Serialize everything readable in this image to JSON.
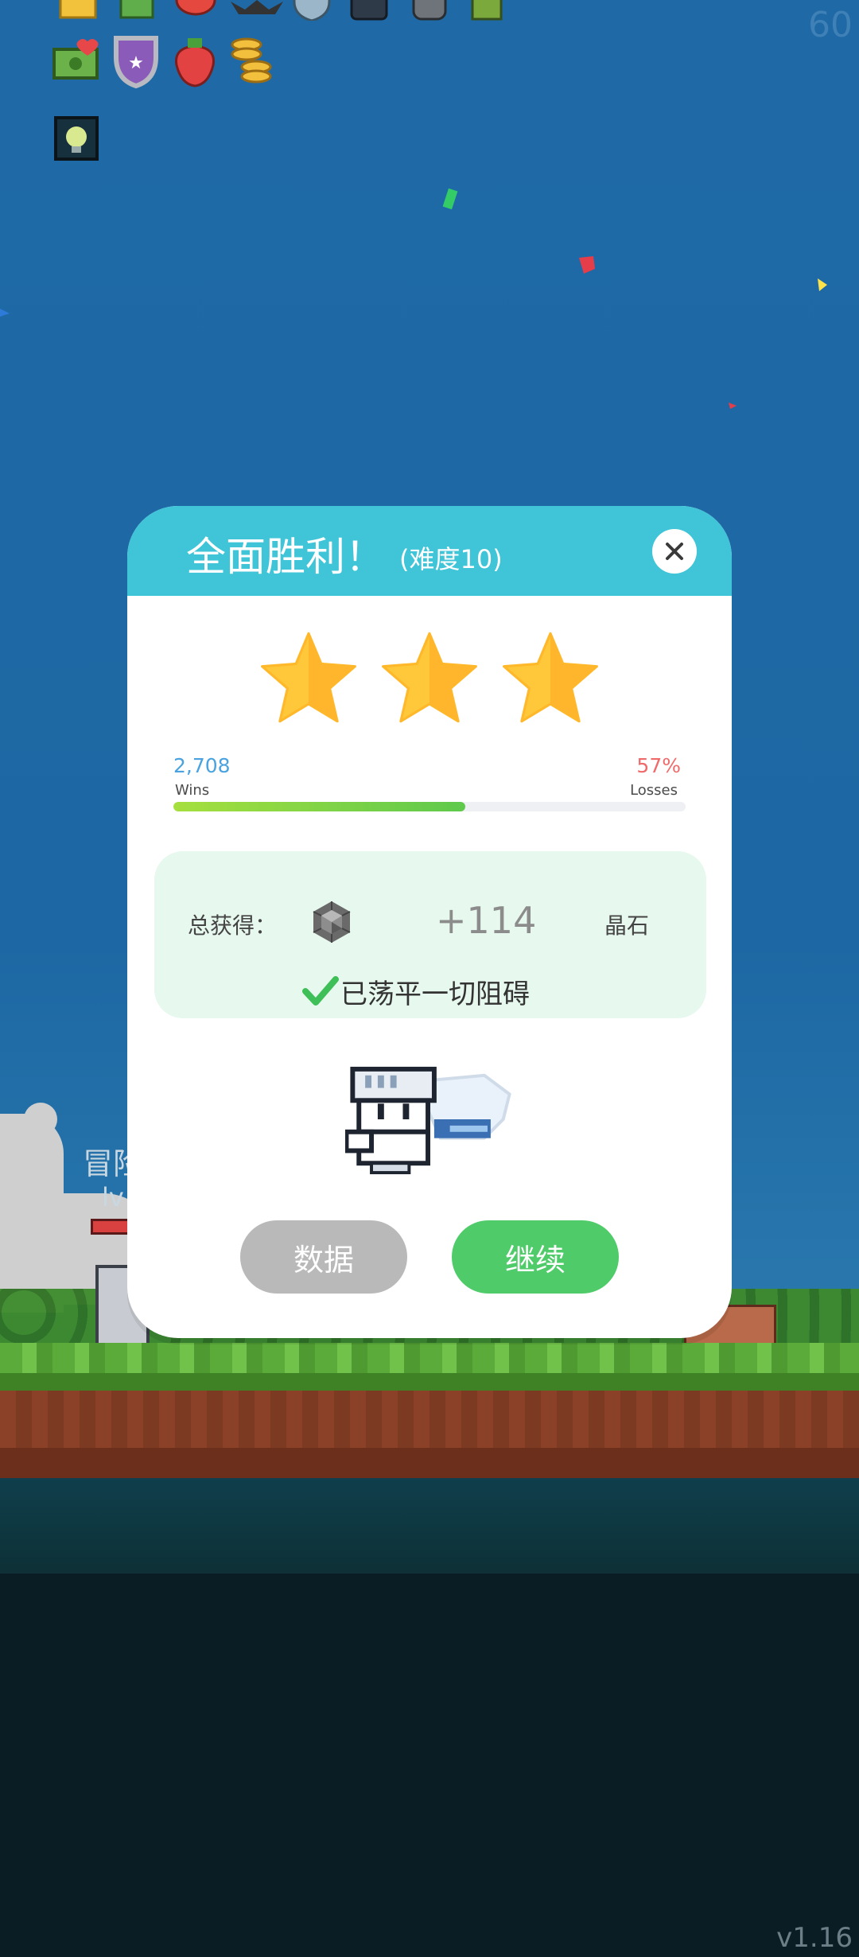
{
  "hud": {
    "fps": "60",
    "version": "v1.16"
  },
  "inventory_icons": [
    "crown-icon",
    "green-card-icon",
    "mushroom-icon",
    "bat-icon",
    "shield-icon",
    "dark-helmet-icon",
    "knight-helmet-icon",
    "goblin-icon",
    "cash-heart-icon",
    "purple-star-shield-icon",
    "strawberry-icon",
    "gold-coins-icon",
    "lightbulb-card-icon"
  ],
  "background": {
    "hero_name_partial": "冒险",
    "hero_level_partial": "lv"
  },
  "modal": {
    "title": "全面胜利！",
    "difficulty": "(难度10)",
    "stars_earned": 3,
    "wins_value": "2,708",
    "wins_label": "Wins",
    "losses_value": "57%",
    "losses_label": "Losses",
    "win_bar_fraction": 0.57,
    "reward_label": "总获得：",
    "reward_icon": "gem-icon",
    "reward_amount": "+114",
    "reward_currency": "晶石",
    "cleared_text": "已荡平一切阻碍",
    "stats_button": "数据",
    "continue_button": "继续"
  },
  "colors": {
    "header": "#3fc4d8",
    "star": "#ffc83a",
    "continue": "#4fcb6a",
    "stats": "#b9b9b9",
    "wins": "#4aa3df",
    "losses": "#ef6b6b"
  }
}
